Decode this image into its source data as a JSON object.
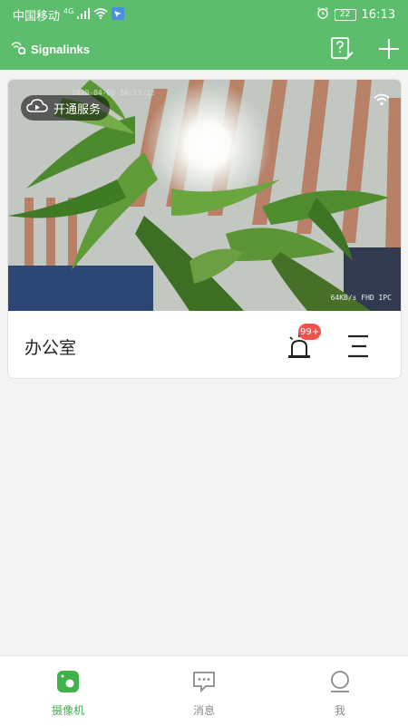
{
  "status_bar": {
    "carrier": "中国移动",
    "network": "4G",
    "battery": "22",
    "time": "16:13"
  },
  "app_bar": {
    "logo_text": "Signalinks"
  },
  "camera_card": {
    "service_button_label": "开通服务",
    "overlay_timestamp": "2020-04-06 16:13:32",
    "overlay_stats": "64KB/s FHD IPC",
    "camera_name": "办公室",
    "alarm_badge": "99+"
  },
  "tabs": [
    {
      "label": "摄像机",
      "active": true
    },
    {
      "label": "消息",
      "active": false
    },
    {
      "label": "我",
      "active": false
    }
  ],
  "colors": {
    "brand_green": "#5cbe6d",
    "badge_red": "#f0524b",
    "tab_active": "#3fb24a",
    "tab_inactive": "#8a8a8a"
  }
}
